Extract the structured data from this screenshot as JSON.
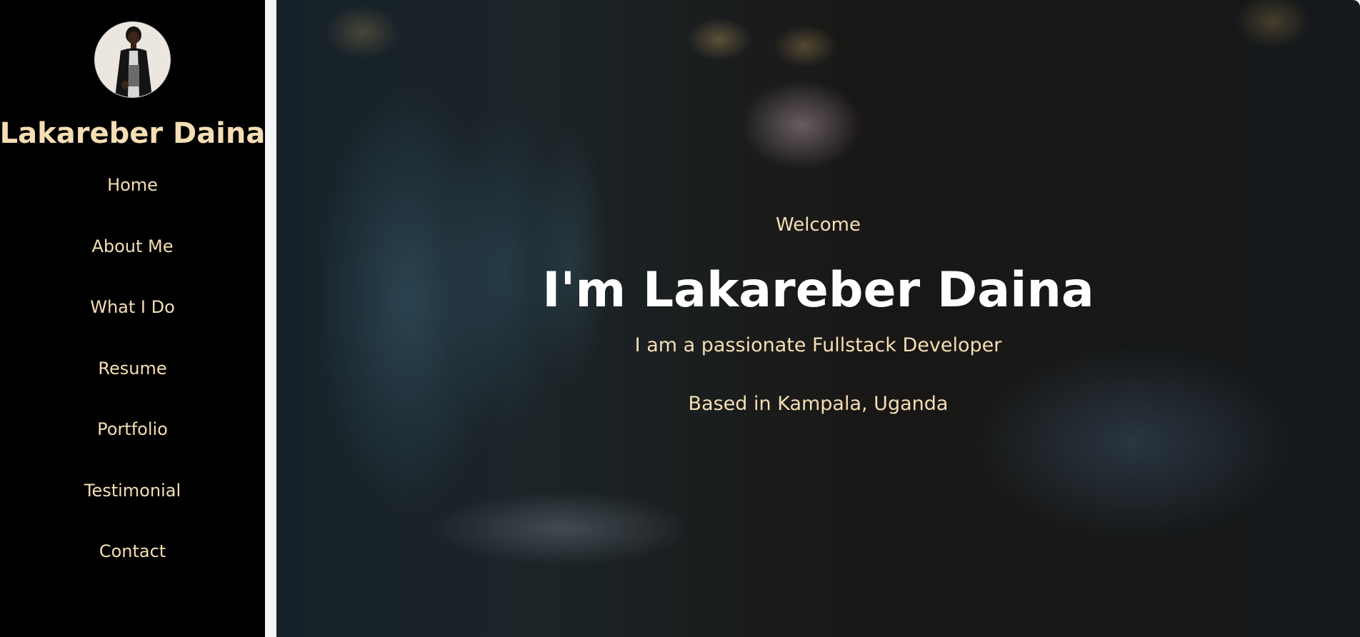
{
  "sidebar": {
    "avatar_icon": "person-photo",
    "brand_name": "Lakareber Daina",
    "nav_items": [
      {
        "label": "Home"
      },
      {
        "label": "About Me"
      },
      {
        "label": "What I Do"
      },
      {
        "label": "Resume"
      },
      {
        "label": "Portfolio"
      },
      {
        "label": "Testimonial"
      },
      {
        "label": "Contact"
      }
    ]
  },
  "hero": {
    "welcome": "Welcome",
    "headline": "I'm Lakareber Daina",
    "tagline": "I am a passionate Fullstack Developer",
    "location": "Based in Kampala, Uganda"
  },
  "colors": {
    "sidebar_bg": "#000000",
    "accent_text": "#f5deb3",
    "headline_text": "#ffffff",
    "divider": "#f3f5f7"
  }
}
